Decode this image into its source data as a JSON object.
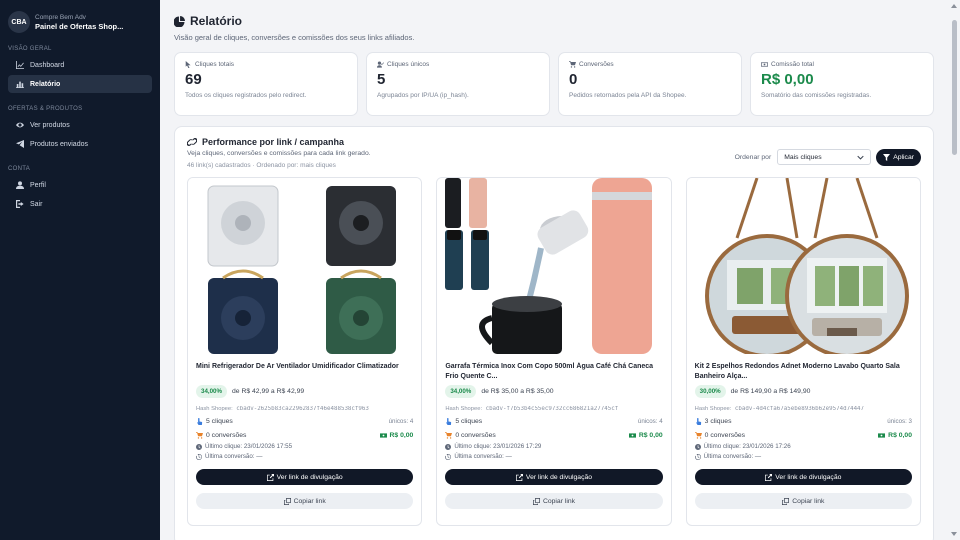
{
  "brand": {
    "logo": "CBA",
    "subtitle": "Compre Bem Adv",
    "title": "Painel de Ofertas Shop..."
  },
  "sidebar": {
    "sections": [
      {
        "label": "VISÃO GERAL",
        "items": [
          {
            "label": "Dashboard",
            "icon": "chart-line-icon"
          },
          {
            "label": "Relatório",
            "icon": "bar-chart-icon",
            "active": true
          }
        ]
      },
      {
        "label": "OFERTAS & PRODUTOS",
        "items": [
          {
            "label": "Ver produtos",
            "icon": "eye-icon"
          },
          {
            "label": "Produtos enviados",
            "icon": "send-icon"
          }
        ]
      },
      {
        "label": "CONTA",
        "items": [
          {
            "label": "Perfil",
            "icon": "user-icon"
          },
          {
            "label": "Sair",
            "icon": "logout-icon"
          }
        ]
      }
    ]
  },
  "header": {
    "title": "Relatório",
    "subtitle": "Visão geral de cliques, conversões e comissões dos seus links afiliados."
  },
  "stats": [
    {
      "label": "Cliques totais",
      "value": "69",
      "desc": "Todos os cliques registrados pelo redirect.",
      "icon": "cursor-icon"
    },
    {
      "label": "Cliques únicos",
      "value": "5",
      "desc": "Agrupados por IP/UA (ip_hash).",
      "icon": "user-check-icon"
    },
    {
      "label": "Conversões",
      "value": "0",
      "desc": "Pedidos retornados pela API da Shopee.",
      "icon": "cart-icon"
    },
    {
      "label": "Comissão total",
      "value": "R$ 0,00",
      "desc": "Somatório das comissões registradas.",
      "icon": "money-icon",
      "color": "#1b8a4b"
    }
  ],
  "performance": {
    "title": "Performance por link / campanha",
    "subtitle": "Veja cliques, conversões e comissões para cada link gerado.",
    "meta": "46 link(s) cadastrados · Ordenado por: mais cliques",
    "order_label": "Ordenar por",
    "order_value": "Mais cliques",
    "apply_label": "Aplicar",
    "cards": [
      {
        "title": "Mini Refrigerador De Ar Ventilador Umidificador Climatizador",
        "pct": "34,00%",
        "price": "de R$ 42,99 a R$ 42,99",
        "hash_label": "Hash Shopee:",
        "hash": "cbadv-2625b83ca22962837f46e488538cf963",
        "clicks": "5 cliques",
        "unique": "únicos: 4",
        "conversions": "0 conversões",
        "commission": "R$ 0,00",
        "last_click": "Último clique: 23/01/2026 17:55",
        "last_conv": "Última conversão: —",
        "btn_link": "Ver link de divulgação",
        "btn_copy": "Copiar link"
      },
      {
        "title": "Garrafa Térmica Inox Com Copo 500ml Água Café Chá Caneca Frio Quente C...",
        "pct": "34,00%",
        "price": "de R$ 35,00 a R$ 35,00",
        "hash_label": "Hash Shopee:",
        "hash": "cbadv-f7b53b4c55ec9732cc686821a27745cf",
        "clicks": "5 cliques",
        "unique": "únicos: 4",
        "conversions": "0 conversões",
        "commission": "R$ 0,00",
        "last_click": "Último clique: 23/01/2026 17:29",
        "last_conv": "Última conversão: —",
        "btn_link": "Ver link de divulgação",
        "btn_copy": "Copiar link"
      },
      {
        "title": "Kit 2 Espelhos Redondos Adnet Moderno Lavabo Quarto Sala Banheiro Alça...",
        "pct": "30,00%",
        "price": "de R$ 149,90 a R$ 149,90",
        "hash_label": "Hash Shopee:",
        "hash": "cbadv-4d4cfa67a5ebe8936b62e9574d74447",
        "clicks": "3 cliques",
        "unique": "únicos: 3",
        "conversions": "0 conversões",
        "commission": "R$ 0,00",
        "last_click": "Último clique: 23/01/2026 17:26",
        "last_conv": "Última conversão: —",
        "btn_link": "Ver link de divulgação",
        "btn_copy": "Copiar link"
      }
    ]
  }
}
